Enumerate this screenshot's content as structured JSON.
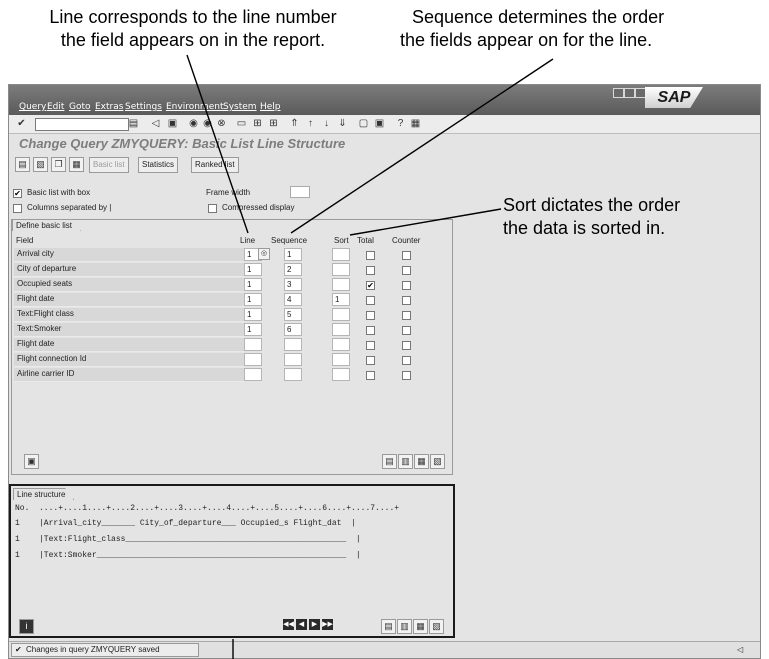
{
  "annotations": {
    "line_callout": [
      "Line corresponds to the line number",
      "the field appears on in the report."
    ],
    "sequence_callout": [
      "Sequence determines the order",
      "the fields appear on for the line."
    ],
    "sort_callout": [
      "Sort dictates the order",
      "the data is sorted in."
    ]
  },
  "menu": [
    "Query",
    "Edit",
    "Goto",
    "Extras",
    "Settings",
    "Environment",
    "System",
    "Help"
  ],
  "brand": "SAP",
  "title": "Change Query ZMYQUERY: Basic List Line Structure",
  "app_buttons": {
    "basic_list": "Basic list",
    "statistics": "Statistics",
    "ranked_list": "Ranked list"
  },
  "options": {
    "basic_list_with_box": "Basic list with box",
    "columns_separated_by": "Columns separated by |",
    "frame_width": "Frame width",
    "compressed_display": "Compressed display"
  },
  "define": {
    "tab": "Define basic list",
    "headers": {
      "field": "Field",
      "line": "Line",
      "sequence": "Sequence",
      "sort": "Sort",
      "total": "Total",
      "counter": "Counter"
    },
    "rows": [
      {
        "field": "Arrival city",
        "line": "1",
        "seq": "1",
        "sort": "",
        "total": false
      },
      {
        "field": "City of departure",
        "line": "1",
        "seq": "2",
        "sort": "",
        "total": false
      },
      {
        "field": "Occupied seats",
        "line": "1",
        "seq": "3",
        "sort": "",
        "total": true
      },
      {
        "field": "Flight date",
        "line": "1",
        "seq": "4",
        "sort": "1",
        "total": false
      },
      {
        "field": "Text:Flight class",
        "line": "1",
        "seq": "5",
        "sort": "",
        "total": false
      },
      {
        "field": "Text:Smoker",
        "line": "1",
        "seq": "6",
        "sort": "",
        "total": false
      },
      {
        "field": "Flight date",
        "line": "",
        "seq": "",
        "sort": "",
        "total": false
      },
      {
        "field": "Flight connection Id",
        "line": "",
        "seq": "",
        "sort": "",
        "total": false
      },
      {
        "field": "Airline carrier ID",
        "line": "",
        "seq": "",
        "sort": "",
        "total": false
      }
    ]
  },
  "line_structure": {
    "tab": "Line structure",
    "ruler": "No.  ....+....1....+....2....+....3....+....4....+....5....+....6....+....7....+",
    "lines": [
      "1    |Arrival_city_______ City_of_departure___ Occupied_s Flight_dat  |",
      "1    |Text:Flight_class______________________________________________  |",
      "1    |Text:Smoker____________________________________________________  |"
    ]
  },
  "status_message": "Changes in query ZMYQUERY saved"
}
